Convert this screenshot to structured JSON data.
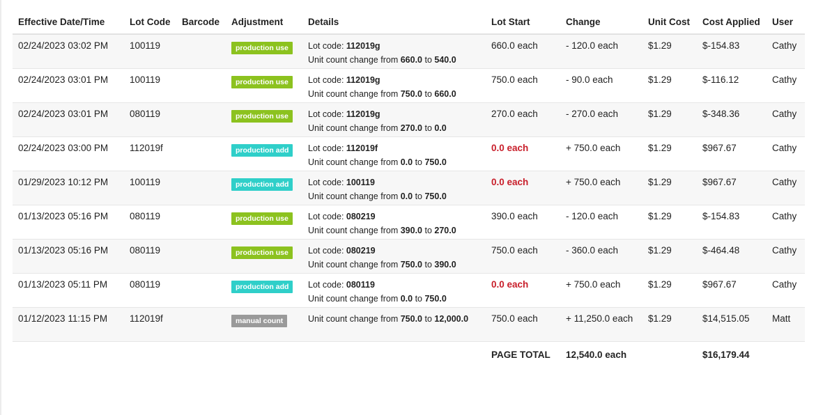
{
  "columns": [
    "Effective Date/Time",
    "Lot Code",
    "Barcode",
    "Adjustment",
    "Details",
    "Lot Start",
    "Change",
    "Unit Cost",
    "Cost Applied",
    "User"
  ],
  "rows": [
    {
      "date": "02/24/2023 03:02 PM",
      "lot": "100119",
      "barcode": "",
      "adjustment": "production use",
      "adj_type": "use",
      "detail_lot": "112019g",
      "detail_from": "660.0",
      "detail_to": "540.0",
      "lot_start": "660.0 each",
      "lot_start_zero": false,
      "change": "- 120.0 each",
      "unit_cost": "$1.29",
      "cost_applied": "$-154.83",
      "user": "Cathy"
    },
    {
      "date": "02/24/2023 03:01 PM",
      "lot": "100119",
      "barcode": "",
      "adjustment": "production use",
      "adj_type": "use",
      "detail_lot": "112019g",
      "detail_from": "750.0",
      "detail_to": "660.0",
      "lot_start": "750.0 each",
      "lot_start_zero": false,
      "change": "- 90.0 each",
      "unit_cost": "$1.29",
      "cost_applied": "$-116.12",
      "user": "Cathy"
    },
    {
      "date": "02/24/2023 03:01 PM",
      "lot": "080119",
      "barcode": "",
      "adjustment": "production use",
      "adj_type": "use",
      "detail_lot": "112019g",
      "detail_from": "270.0",
      "detail_to": "0.0",
      "lot_start": "270.0 each",
      "lot_start_zero": false,
      "change": "- 270.0 each",
      "unit_cost": "$1.29",
      "cost_applied": "$-348.36",
      "user": "Cathy"
    },
    {
      "date": "02/24/2023 03:00 PM",
      "lot": "112019f",
      "barcode": "",
      "adjustment": "production add",
      "adj_type": "add",
      "detail_lot": "112019f",
      "detail_from": "0.0",
      "detail_to": "750.0",
      "lot_start": "0.0 each",
      "lot_start_zero": true,
      "change": "+ 750.0 each",
      "unit_cost": "$1.29",
      "cost_applied": "$967.67",
      "user": "Cathy"
    },
    {
      "date": "01/29/2023 10:12 PM",
      "lot": "100119",
      "barcode": "",
      "adjustment": "production add",
      "adj_type": "add",
      "detail_lot": "100119",
      "detail_from": "0.0",
      "detail_to": "750.0",
      "lot_start": "0.0 each",
      "lot_start_zero": true,
      "change": "+ 750.0 each",
      "unit_cost": "$1.29",
      "cost_applied": "$967.67",
      "user": "Cathy"
    },
    {
      "date": "01/13/2023 05:16 PM",
      "lot": "080119",
      "barcode": "",
      "adjustment": "production use",
      "adj_type": "use",
      "detail_lot": "080219",
      "detail_from": "390.0",
      "detail_to": "270.0",
      "lot_start": "390.0 each",
      "lot_start_zero": false,
      "change": "- 120.0 each",
      "unit_cost": "$1.29",
      "cost_applied": "$-154.83",
      "user": "Cathy"
    },
    {
      "date": "01/13/2023 05:16 PM",
      "lot": "080119",
      "barcode": "",
      "adjustment": "production use",
      "adj_type": "use",
      "detail_lot": "080219",
      "detail_from": "750.0",
      "detail_to": "390.0",
      "lot_start": "750.0 each",
      "lot_start_zero": false,
      "change": "- 360.0 each",
      "unit_cost": "$1.29",
      "cost_applied": "$-464.48",
      "user": "Cathy"
    },
    {
      "date": "01/13/2023 05:11 PM",
      "lot": "080119",
      "barcode": "",
      "adjustment": "production add",
      "adj_type": "add",
      "detail_lot": "080119",
      "detail_from": "0.0",
      "detail_to": "750.0",
      "lot_start": "0.0 each",
      "lot_start_zero": true,
      "change": "+ 750.0 each",
      "unit_cost": "$1.29",
      "cost_applied": "$967.67",
      "user": "Cathy"
    },
    {
      "date": "01/12/2023 11:15 PM",
      "lot": "112019f",
      "barcode": "",
      "adjustment": "manual count",
      "adj_type": "manual",
      "detail_lot": "",
      "detail_from": "750.0",
      "detail_to": "12,000.0",
      "lot_start": "750.0 each",
      "lot_start_zero": false,
      "change": "+ 11,250.0 each",
      "unit_cost": "$1.29",
      "cost_applied": "$14,515.05",
      "user": "Matt"
    }
  ],
  "detail_labels": {
    "lot_code": "Lot code: ",
    "count_change": "Unit count change from ",
    "to": " to "
  },
  "totals": {
    "label": "PAGE TOTAL",
    "change": "12,540.0 each",
    "cost_applied": "$16,179.44"
  },
  "colors": {
    "production_use": "#8cc21f",
    "production_add": "#2fcfc9",
    "manual_count": "#9a9a9a",
    "zero_value": "#c81e2a"
  }
}
